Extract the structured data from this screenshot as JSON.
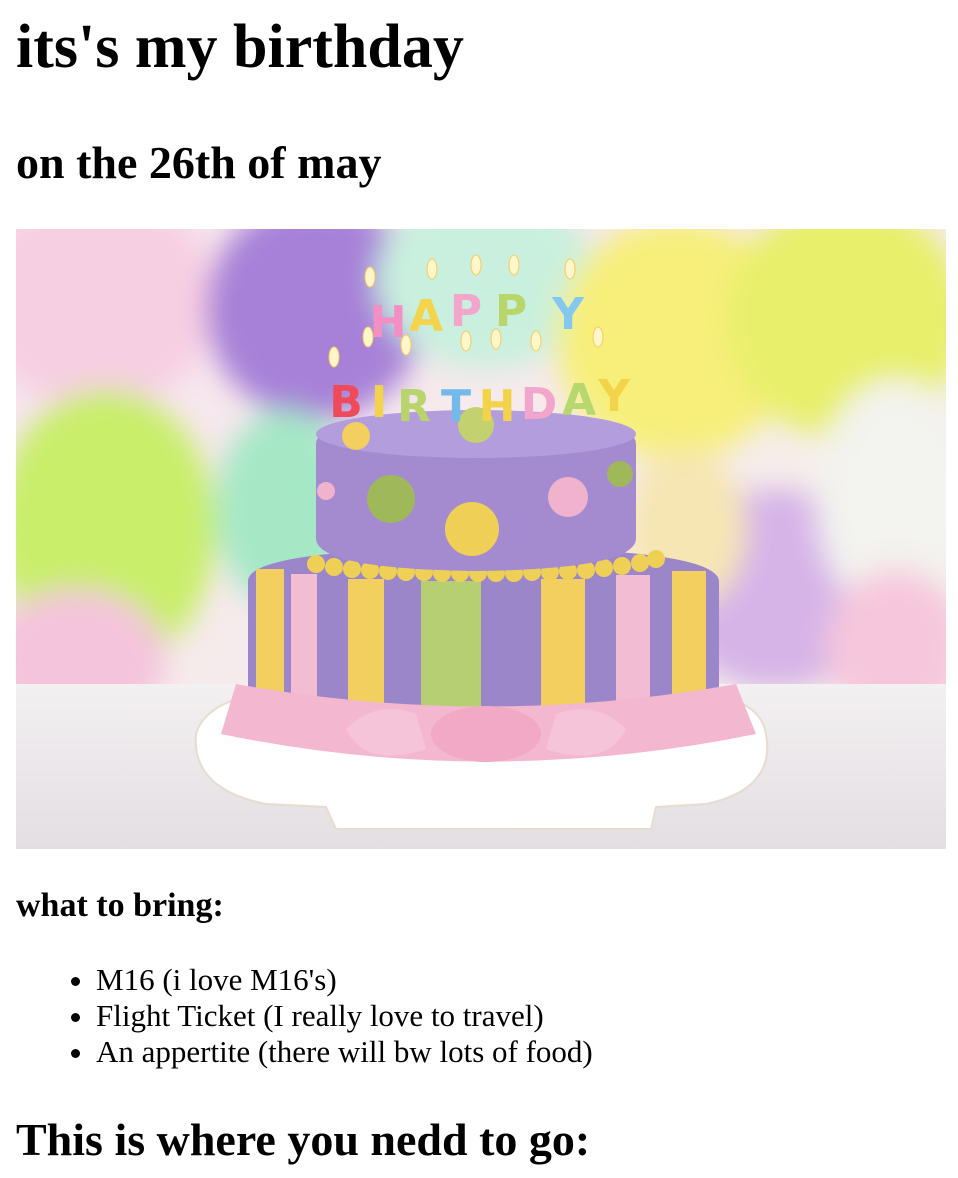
{
  "heading": "its's my birthday",
  "subheading": "on the 26th of may",
  "image": {
    "description_icon": "birthday-cake-image",
    "candle_text_top": "HAPPY",
    "candle_text_bottom": "BIRTHDAY"
  },
  "bring": {
    "title": "what to bring:",
    "items": [
      "M16 (i love M16's)",
      "Flight Ticket (I really love to travel)",
      "An appertite (there will bw lots of food)"
    ]
  },
  "directions": {
    "title": "This is where you nedd to go:"
  },
  "colors": {
    "text": "#000000",
    "background": "#ffffff",
    "cake_purple": "#9b86c9",
    "cake_pink": "#f2bcd3",
    "cake_yellow": "#f2cf5e",
    "cake_green": "#b6cf73"
  }
}
